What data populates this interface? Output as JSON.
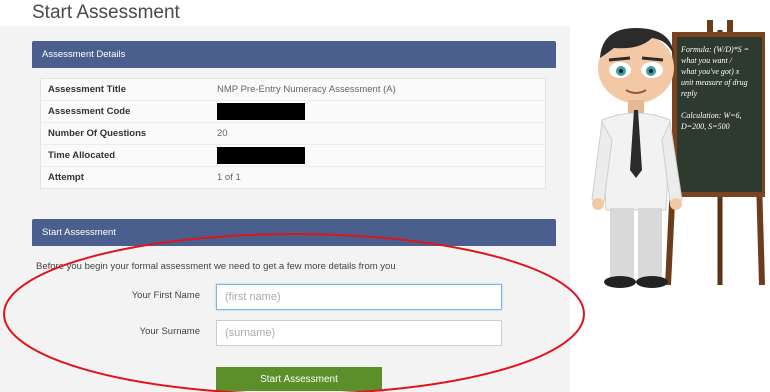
{
  "page": {
    "title": "Start Assessment"
  },
  "details": {
    "header": "Assessment Details",
    "rows": [
      {
        "label": "Assessment Title",
        "value": "NMP Pre-Entry Numeracy Assessment (A)",
        "redacted": false
      },
      {
        "label": "Assessment Code",
        "value": "",
        "redacted": true
      },
      {
        "label": "Number Of Questions",
        "value": "20",
        "redacted": false
      },
      {
        "label": "Time Allocated",
        "value": "",
        "redacted": true
      },
      {
        "label": "Attempt",
        "value": "1 of 1",
        "redacted": false
      }
    ]
  },
  "start": {
    "header": "Start Assessment",
    "intro": "Before you begin your formal assessment we need to get a few more details from you",
    "first_name_label": "Your First Name",
    "first_name_placeholder": "(first name)",
    "surname_label": "Your Surname",
    "surname_placeholder": "(surname)",
    "button_label": "Start Assessment"
  },
  "blackboard": {
    "lines": [
      "Formula: (W/D)*S =",
      "what you want /",
      "what you've got) x",
      "unit measure of drug",
      "reply",
      "",
      "Calculation: W=6,",
      "D=200, S=500"
    ]
  },
  "colors": {
    "panel_header": "#4b5f8e",
    "button": "#5a8f2a",
    "annotation": "#e0141b"
  }
}
